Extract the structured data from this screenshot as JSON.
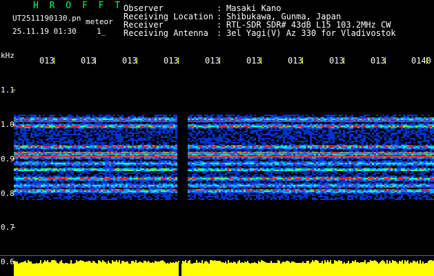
{
  "header": {
    "app_title": "H R O F F T",
    "filename": "UT2511190130.pn",
    "meteor_label": "meteor",
    "datetime": "25.11.19 01:30",
    "page": "1_"
  },
  "meta": [
    {
      "label": "Observer",
      "value": "Masaki Kano"
    },
    {
      "label": "Receiving Location",
      "value": "Shibukawa, Gunma, Japan"
    },
    {
      "label": "Receiver",
      "value": "RTL-SDR SDR# 43dB L15 103.2MHz CW"
    },
    {
      "label": "Receiving Antenna",
      "value": "3el Yagi(V) Az 330 for Vladivostok"
    }
  ],
  "axis": {
    "unit": "kHz",
    "time_ticks": [
      "013",
      "013",
      "013",
      "013",
      "013",
      "013",
      "013",
      "013",
      "013",
      "0140"
    ],
    "freq_ticks": [
      "1.1",
      "1.0",
      "0.9",
      "0.8",
      "0.7",
      "0.6"
    ]
  },
  "colors": {
    "background": "#000000",
    "title": "#00ff66",
    "text": "#ffffff",
    "tick": "#ffff00",
    "signal_low": "#0022aa",
    "signal_high": "#ff2020",
    "level": "#ffff00"
  }
}
